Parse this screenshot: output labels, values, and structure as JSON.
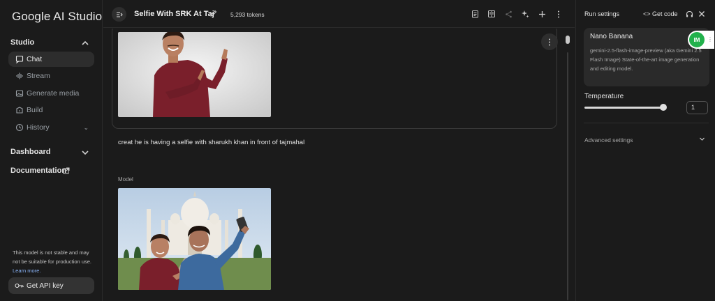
{
  "app": {
    "logo_text": "Google AI Studio"
  },
  "sidebar": {
    "studio_label": "Studio",
    "items": [
      {
        "label": "Chat",
        "icon": "chat-icon"
      },
      {
        "label": "Stream",
        "icon": "stream-icon"
      },
      {
        "label": "Generate media",
        "icon": "media-icon"
      },
      {
        "label": "Build",
        "icon": "build-icon"
      },
      {
        "label": "History",
        "icon": "history-icon"
      }
    ],
    "dashboard_label": "Dashboard",
    "documentation_label": "Documentation",
    "note_text": "This model is not stable and may not be suitable for production use.",
    "note_link": "Learn more.",
    "api_key_label": "Get API key"
  },
  "topbar": {
    "prompt_title": "Selfie With SRK At Taj",
    "token_count": "5,293 tokens"
  },
  "chat": {
    "user_message": "creat he is having a selfie with sharukh khan in front of tajmahal",
    "model_label": "Model"
  },
  "run_settings": {
    "title": "Run settings",
    "get_code_label": "Get code",
    "model_name": "Nano Banana",
    "model_description": "gemini-2.5-flash-image-preview (aka Gemini 2.5 Flash Image) State-of-the-art image generation and editing model.",
    "extension_badge": "IM",
    "temperature_label": "Temperature",
    "temperature_value": "1",
    "temperature_fraction": 1.0,
    "advanced_settings_label": "Advanced settings"
  },
  "colors": {
    "background": "#1b1b1b",
    "active_item": "#2d2d2d",
    "link": "#8ab4f8",
    "badge_green": "#22b14c"
  }
}
